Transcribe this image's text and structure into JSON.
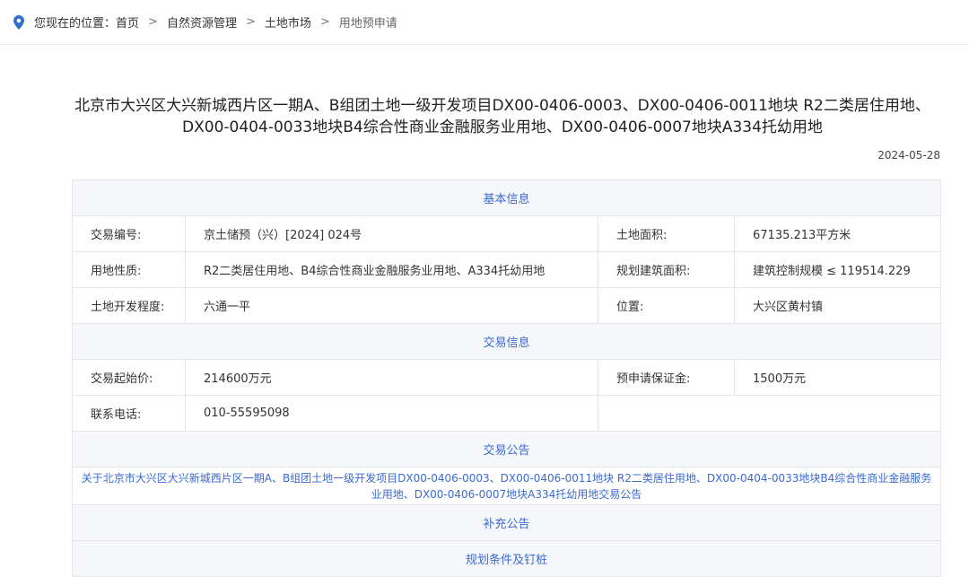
{
  "breadcrumb": {
    "prefix": "您现在的位置：",
    "items": [
      "首页",
      "自然资源管理",
      "土地市场",
      "用地预申请"
    ],
    "separator": ">"
  },
  "title": "北京市大兴区大兴新城西片区一期A、B组团土地一级开发项目DX00-0406-0003、DX00-0406-0011地块 R2二类居住用地、DX00-0404-0033地块B4综合性商业金融服务业用地、DX00-0406-0007地块A334托幼用地",
  "date": "2024-05-28",
  "sections": {
    "basic": "基本信息",
    "trade": "交易信息",
    "announcement": "交易公告",
    "supplement": "补充公告",
    "planning": "规划条件及钉桩"
  },
  "basic": {
    "trade_no_label": "交易编号:",
    "trade_no": "京土储预（兴）[2024] 024号",
    "area_label": "土地面积:",
    "area": "67135.213平方米",
    "nature_label": "用地性质:",
    "nature": "R2二类居住用地、B4综合性商业金融服务业用地、A334托幼用地",
    "build_area_label": "规划建筑面积:",
    "build_area": "建筑控制规模 ≤ 119514.229",
    "dev_label": "土地开发程度:",
    "dev": "六通一平",
    "location_label": "位置:",
    "location": "大兴区黄村镇"
  },
  "trade": {
    "start_price_label": "交易起始价:",
    "start_price": "214600万元",
    "deposit_label": "预申请保证金:",
    "deposit": "1500万元",
    "phone_label": "联系电话:",
    "phone": "010-55595098"
  },
  "announcement_link": "关于北京市大兴区大兴新城西片区一期A、B组团土地一级开发项目DX00-0406-0003、DX00-0406-0011地块 R2二类居住用地、DX00-0404-0033地块B4综合性商业金融服务业用地、DX00-0406-0007地块A334托幼用地交易公告",
  "colors": {
    "accent": "#3a6ad4",
    "section_bg": "#f5f7fa",
    "pin": "#2f6fd0"
  },
  "icons": {
    "location": "map-pin-icon"
  }
}
